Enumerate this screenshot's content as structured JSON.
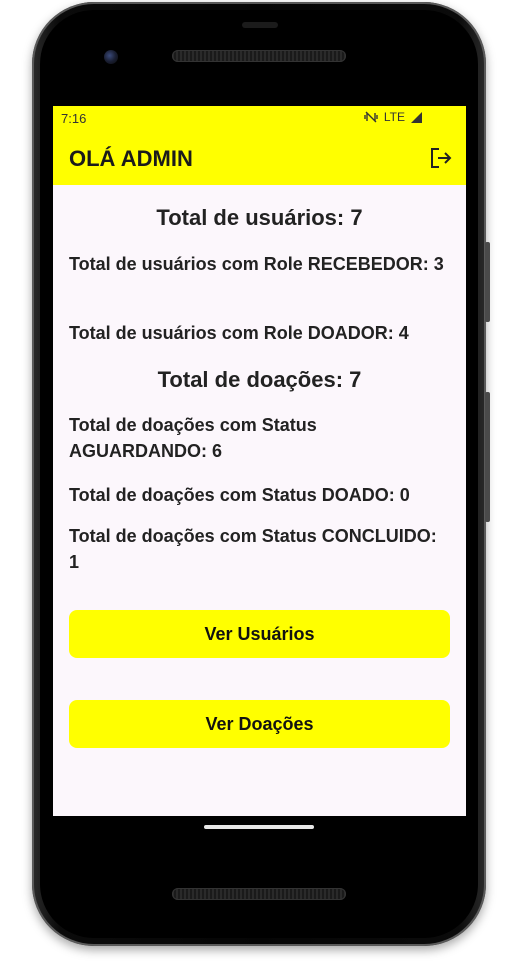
{
  "status_bar": {
    "time": "7:16",
    "network": "LTE"
  },
  "app_bar": {
    "title": "OLÁ ADMIN",
    "logout_icon": "logout-icon",
    "color": "#ffff00"
  },
  "stats": {
    "total_users": "Total de usuários: 7",
    "users_recebedor": "Total de usuários com Role RECEBEDOR: 3",
    "users_doador": "Total de usuários com Role DOADOR: 4",
    "total_donations": "Total de doações: 7",
    "donations_aguardando": "Total de doações com Status AGUARDANDO: 6",
    "donations_doado": "Total de doações com Status DOADO: 0",
    "donations_concluido": "Total de doações com Status CONCLUIDO: 1"
  },
  "actions": {
    "view_users_label": "Ver Usuários",
    "view_donations_label": "Ver Doações"
  }
}
